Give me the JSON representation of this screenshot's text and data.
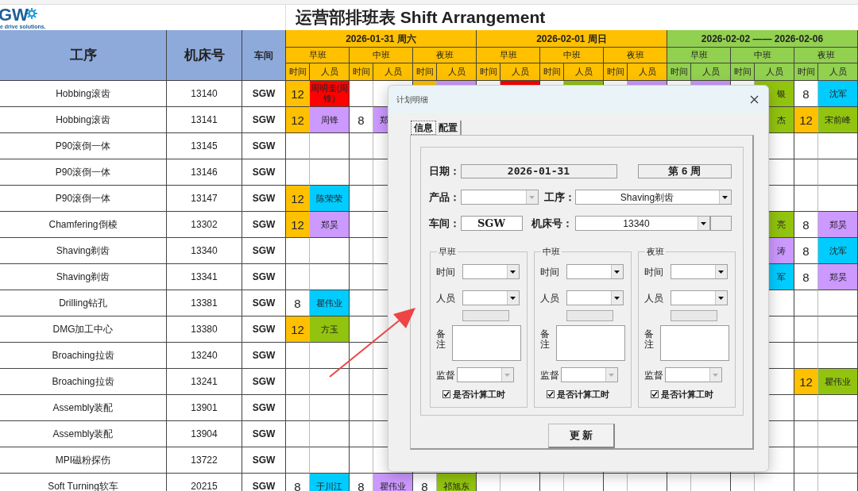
{
  "logo": {
    "mark": "GW",
    "tagline": "e drive solutions."
  },
  "title": "运营部排班表 Shift Arrangement",
  "headers": {
    "process": "工序",
    "machine": "机床号",
    "workshop": "车间"
  },
  "days": [
    {
      "label": "2026-01-31 周六",
      "color": "#ffc000",
      "shifts": [
        {
          "name": "早班",
          "time": "时间",
          "staff": "人员"
        },
        {
          "name": "中班",
          "time": "时间",
          "staff": "人员"
        },
        {
          "name": "夜班",
          "time": "时间",
          "staff": "人员"
        }
      ]
    },
    {
      "label": "2026-02-01 周日",
      "color": "#ffc000",
      "shifts": [
        {
          "name": "早班",
          "time": "时间",
          "staff": "人员"
        },
        {
          "name": "中班",
          "time": "时间",
          "staff": "人员"
        },
        {
          "name": "夜班",
          "time": "时间",
          "staff": "人员"
        }
      ]
    },
    {
      "label": "2026-02-02 —— 2026-02-06",
      "color": "#92d050",
      "shifts": [
        {
          "name": "早班",
          "time": "时间",
          "staff": "人员"
        },
        {
          "name": "中班",
          "time": "时间",
          "staff": "人员"
        },
        {
          "name": "夜班",
          "time": "时间",
          "staff": "人员"
        }
      ]
    }
  ],
  "rows": [
    {
      "process": "Hobbing滚齿",
      "machine": "13140",
      "workshop": "SGW",
      "cells": [
        {
          "text": "12",
          "color": "#ffc000"
        },
        {
          "text": "周明奎(周锋)",
          "color": "#ff0000"
        },
        null,
        null,
        {
          "color": "#ffc000"
        },
        {
          "color": "#cc99ff"
        },
        null,
        {
          "color": "#ff0000"
        },
        null,
        {
          "color": "#92c40f"
        },
        null,
        {
          "color": "#cc99ff"
        },
        null,
        {
          "color": "#cc99ff"
        },
        null,
        {
          "text": "银",
          "color": "#92c40f"
        },
        {
          "text": "8"
        },
        {
          "text": "沈军",
          "color": "#00ccff"
        }
      ]
    },
    {
      "process": "Hobbing滚齿",
      "machine": "13141",
      "workshop": "SGW",
      "cells": [
        {
          "text": "12",
          "color": "#ffc000"
        },
        {
          "text": "周锋",
          "color": "#cc99ff"
        },
        {
          "text": "8"
        },
        {
          "text": "郑",
          "color": "#cc99ff"
        },
        null,
        null,
        null,
        null,
        null,
        null,
        null,
        null,
        null,
        null,
        null,
        {
          "text": "杰",
          "color": "#92c40f"
        },
        {
          "text": "12",
          "color": "#ffc000"
        },
        {
          "text": "宋前峰",
          "color": "#92c40f"
        }
      ]
    },
    {
      "process": "P90滚倒一体",
      "machine": "13145",
      "workshop": "SGW",
      "cells": [
        null,
        null,
        null,
        null,
        null,
        null,
        null,
        null,
        null,
        null,
        null,
        null,
        null,
        null,
        null,
        null,
        null,
        null
      ]
    },
    {
      "process": "P90滚倒一体",
      "machine": "13146",
      "workshop": "SGW",
      "cells": [
        null,
        null,
        null,
        null,
        null,
        null,
        null,
        null,
        null,
        null,
        null,
        null,
        null,
        null,
        null,
        null,
        null,
        null
      ]
    },
    {
      "process": "P90滚倒一体",
      "machine": "13147",
      "workshop": "SGW",
      "cells": [
        {
          "text": "12",
          "color": "#ffc000"
        },
        {
          "text": "陈荣荣",
          "color": "#00ccff"
        },
        null,
        null,
        null,
        null,
        null,
        null,
        null,
        null,
        null,
        null,
        null,
        null,
        null,
        null,
        null,
        null
      ]
    },
    {
      "process": "Chamfering倒棱",
      "machine": "13302",
      "workshop": "SGW",
      "cells": [
        {
          "text": "12",
          "color": "#ffc000"
        },
        {
          "text": "郑昊",
          "color": "#cc99ff"
        },
        null,
        null,
        null,
        null,
        null,
        null,
        null,
        null,
        null,
        null,
        null,
        null,
        null,
        {
          "text": "亮",
          "color": "#92c40f"
        },
        {
          "text": "8"
        },
        {
          "text": "郑昊",
          "color": "#cc99ff"
        }
      ]
    },
    {
      "process": "Shaving剃齿",
      "machine": "13340",
      "workshop": "SGW",
      "cells": [
        null,
        null,
        null,
        null,
        null,
        null,
        null,
        null,
        null,
        null,
        null,
        null,
        null,
        null,
        null,
        {
          "text": "涛",
          "color": "#cc99ff"
        },
        {
          "text": "8"
        },
        {
          "text": "沈军",
          "color": "#00ccff"
        }
      ]
    },
    {
      "process": "Shaving剃齿",
      "machine": "13341",
      "workshop": "SGW",
      "cells": [
        null,
        null,
        null,
        null,
        null,
        null,
        null,
        null,
        null,
        null,
        null,
        null,
        null,
        null,
        null,
        {
          "text": "军",
          "color": "#00ccff"
        },
        {
          "text": "8"
        },
        {
          "text": "郑昊",
          "color": "#cc99ff"
        }
      ]
    },
    {
      "process": "Drilling钻孔",
      "machine": "13381",
      "workshop": "SGW",
      "cells": [
        {
          "text": "8"
        },
        {
          "text": "瞿伟业",
          "color": "#00ccff"
        },
        null,
        null,
        null,
        null,
        null,
        null,
        null,
        null,
        null,
        null,
        null,
        null,
        null,
        null,
        null,
        null
      ]
    },
    {
      "process": "DMG加工中心",
      "machine": "13380",
      "workshop": "SGW",
      "cells": [
        {
          "text": "12",
          "color": "#ffc000"
        },
        {
          "text": "方玉",
          "color": "#92c40f"
        },
        null,
        null,
        null,
        null,
        null,
        null,
        null,
        null,
        null,
        null,
        null,
        null,
        null,
        null,
        null,
        null
      ]
    },
    {
      "process": "Broaching拉齿",
      "machine": "13240",
      "workshop": "SGW",
      "cells": [
        null,
        null,
        null,
        null,
        null,
        null,
        null,
        null,
        null,
        null,
        null,
        null,
        null,
        null,
        null,
        null,
        null,
        null
      ]
    },
    {
      "process": "Broaching拉齿",
      "machine": "13241",
      "workshop": "SGW",
      "cells": [
        null,
        null,
        null,
        null,
        null,
        null,
        null,
        null,
        null,
        null,
        null,
        null,
        null,
        null,
        null,
        null,
        {
          "text": "12",
          "color": "#ffc000"
        },
        {
          "text": "瞿伟业",
          "color": "#92c40f"
        }
      ]
    },
    {
      "process": "Assembly装配",
      "machine": "13901",
      "workshop": "SGW",
      "cells": [
        null,
        null,
        null,
        null,
        null,
        null,
        null,
        null,
        null,
        null,
        null,
        null,
        null,
        null,
        null,
        null,
        null,
        null
      ]
    },
    {
      "process": "Assembly装配",
      "machine": "13904",
      "workshop": "SGW",
      "cells": [
        null,
        null,
        null,
        null,
        null,
        null,
        null,
        null,
        null,
        null,
        null,
        null,
        null,
        null,
        null,
        null,
        null,
        null
      ]
    },
    {
      "process": "MPI磁粉探伤",
      "machine": "13722",
      "workshop": "SGW",
      "cells": [
        null,
        null,
        null,
        null,
        null,
        null,
        null,
        null,
        null,
        null,
        null,
        null,
        null,
        null,
        null,
        null,
        null,
        null
      ]
    },
    {
      "process": "Soft Turning软车",
      "machine": "20215",
      "workshop": "SGW",
      "cells": [
        {
          "text": "8"
        },
        {
          "text": "于川江",
          "color": "#00ccff"
        },
        {
          "text": "8"
        },
        {
          "text": "瞿伟业",
          "color": "#cc99ff"
        },
        {
          "text": "8"
        },
        {
          "text": "祁旭东",
          "color": "#92c40f"
        },
        null,
        null,
        null,
        null,
        null,
        null,
        null,
        null,
        null,
        null,
        null,
        null
      ]
    }
  ],
  "dialog": {
    "title": "计划明细",
    "tabs": [
      {
        "label": "信息",
        "selected": true
      },
      {
        "label": "配置",
        "selected": false
      }
    ],
    "date": {
      "label": "日期：",
      "value": "2026-01-31"
    },
    "week": "第 6 周",
    "product": {
      "label": "产品：",
      "disabled": true
    },
    "process": {
      "label": "工序：",
      "value": "Shaving剃齿"
    },
    "workshop": {
      "label": "车间：",
      "value": "SGW"
    },
    "machine": {
      "label": "机床号：",
      "value": "13340"
    },
    "shifts": [
      {
        "title": "早班",
        "time_label": "时间",
        "staff_label": "人员",
        "note_label": "备注",
        "supervisor_label": "监督",
        "supervisor_disabled": true,
        "count_hours": {
          "label": "是否计算工时",
          "checked": true
        }
      },
      {
        "title": "中班",
        "time_label": "时间",
        "staff_label": "人员",
        "note_label": "备注",
        "supervisor_label": "监督",
        "supervisor_disabled": true,
        "count_hours": {
          "label": "是否计算工时",
          "checked": true
        }
      },
      {
        "title": "夜班",
        "time_label": "时间",
        "staff_label": "人员",
        "note_label": "备注",
        "supervisor_label": "监督",
        "supervisor_disabled": true,
        "count_hours": {
          "label": "是否计算工时",
          "checked": true
        }
      }
    ],
    "update_button": "更 新"
  }
}
